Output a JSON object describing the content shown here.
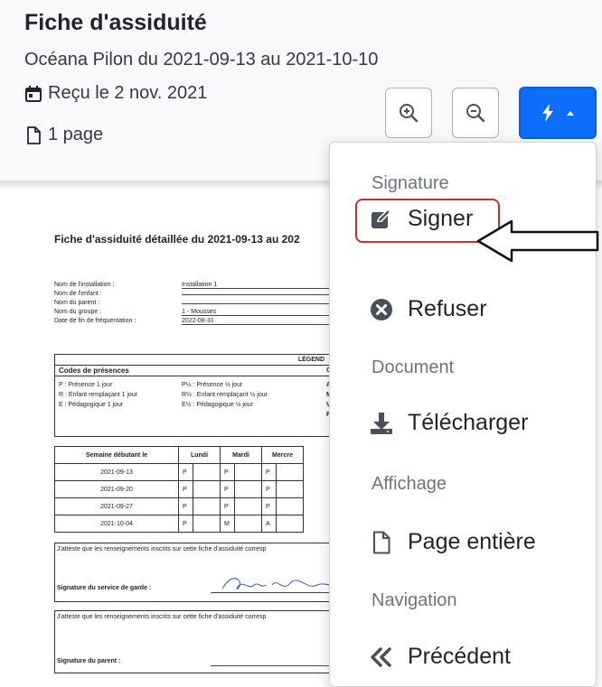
{
  "header": {
    "title": "Fiche d'assiduité",
    "subtitle": "Océana Pilon du 2021-09-13 au 2021-10-10",
    "received": "Reçu le 2 nov. 2021",
    "pages": "1 page",
    "zoom_in_icon": "zoom-in-icon",
    "zoom_out_icon": "zoom-out-icon",
    "action_icon": "lightning-icon",
    "accent": "#0d6efd"
  },
  "document": {
    "title": "Fiche d'assiduité détaillée du 2021-09-13 au 202",
    "info": [
      {
        "label": "Nom de l'installation :",
        "value": "Installation 1"
      },
      {
        "label": "Nom de l'enfant :",
        "value": ""
      },
      {
        "label": "Nom du parent :",
        "value": ""
      },
      {
        "label": "Nom du groupe :",
        "value": "1 - Mousses"
      },
      {
        "label": "Date de fin de fréquentation :",
        "value": "2022-08-31"
      }
    ],
    "legend_title": "LÉGEND",
    "codes_title": "Codes de présences",
    "codes": [
      "P :  Présence 1 jour",
      "R :  Enfant remplaçant 1 jour",
      "E :  Pédagogique 1 jour"
    ],
    "codes_half": [
      "P½ :  Présence ½ jour",
      "R½ :  Enfant remplaçant ½ jour",
      "E½ :  Pédagogique ½ jour"
    ],
    "codes_right_letters": [
      "C",
      "A",
      "M",
      "V",
      "F"
    ],
    "table_headers": [
      "Semaine débutant le",
      "Lundi",
      "Mardi",
      "Mercre"
    ],
    "weeks": [
      {
        "week": "2021-09-13",
        "mon": "P",
        "tue": "P",
        "wed": "P"
      },
      {
        "week": "2021-09-20",
        "mon": "P",
        "tue": "P",
        "wed": "P"
      },
      {
        "week": "2021-09-27",
        "mon": "P",
        "tue": "P",
        "wed": "P"
      },
      {
        "week": "2021-10-04",
        "mon": "P",
        "tue": "M",
        "wed": "A"
      }
    ],
    "attest_text": "J'atteste que les renseignements inscrits sur cette fiche d'assiduité corresp",
    "sig_service": "Signature du service de garde :",
    "sig_parent": "Signature du parent :"
  },
  "menu": {
    "section_signature": "Signature",
    "sign": "Signer",
    "refuse": "Refuser",
    "section_document": "Document",
    "download": "Télécharger",
    "section_display": "Affichage",
    "full_page": "Page entière",
    "section_navigation": "Navigation",
    "previous": "Précédent",
    "highlight_color": "#d62828"
  }
}
